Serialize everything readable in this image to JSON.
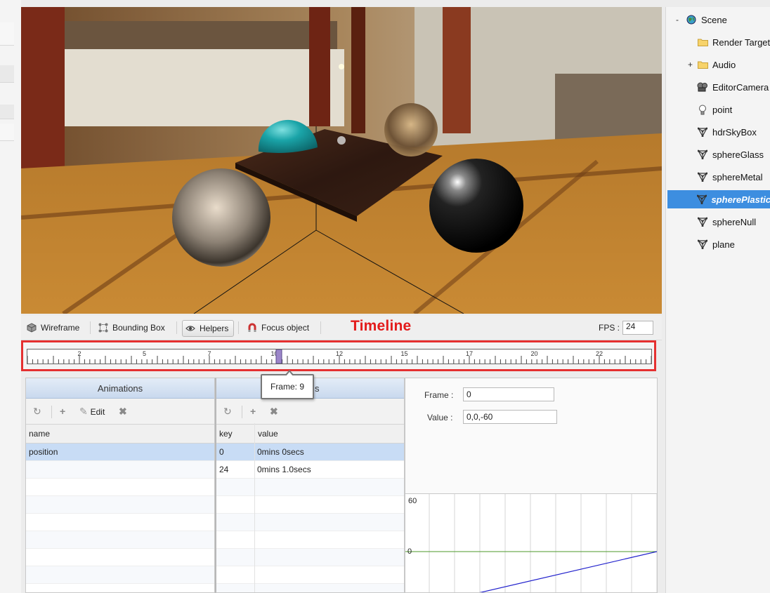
{
  "toolbar": {
    "wireframe_label": "Wireframe",
    "bounding_box_label": "Bounding Box",
    "helpers_label": "Helpers",
    "focus_object_label": "Focus object",
    "timeline_title": "Timeline",
    "fps_label": "FPS :",
    "fps_value": "24"
  },
  "timeline": {
    "tick_labels": [
      "2",
      "5",
      "7",
      "10",
      "12",
      "15",
      "17",
      "20",
      "22"
    ],
    "current_frame": 9,
    "tooltip": "Frame: 9"
  },
  "animations_panel": {
    "title": "Animations",
    "edit_label": "Edit",
    "column_name": "name",
    "rows": [
      {
        "name": "position"
      }
    ]
  },
  "keys_panel": {
    "title_suffix": "s",
    "column_key": "key",
    "column_value": "value",
    "rows": [
      {
        "key": "0",
        "value": "0mins 0secs"
      },
      {
        "key": "24",
        "value": "0mins 1.0secs"
      }
    ]
  },
  "properties": {
    "frame_label": "Frame :",
    "frame_value": "0",
    "value_label": "Value :",
    "value_value": "0,0,-60"
  },
  "curve_graph": {
    "y_top_label": "60",
    "y_zero_label": "0"
  },
  "scene_tree": {
    "root": "Scene",
    "root_expander": "-",
    "audio_expander": "+",
    "items": [
      {
        "label": "Render Targets",
        "icon": "folder-icon"
      },
      {
        "label": "Audio",
        "icon": "folder-icon"
      },
      {
        "label": "EditorCamera",
        "icon": "camera-icon"
      },
      {
        "label": "point",
        "icon": "lightbulb-icon"
      },
      {
        "label": "hdrSkyBox",
        "icon": "mesh-icon"
      },
      {
        "label": "sphereGlass",
        "icon": "mesh-icon"
      },
      {
        "label": "sphereMetal",
        "icon": "mesh-icon"
      },
      {
        "label": "spherePlastic",
        "icon": "mesh-icon",
        "selected": true
      },
      {
        "label": "sphereNull",
        "icon": "mesh-icon"
      },
      {
        "label": "plane",
        "icon": "mesh-icon"
      }
    ]
  },
  "colors": {
    "timeline_highlight": "#e53030",
    "selection": "#3d8ee0",
    "grid_row_selected": "#c8dcf5"
  }
}
